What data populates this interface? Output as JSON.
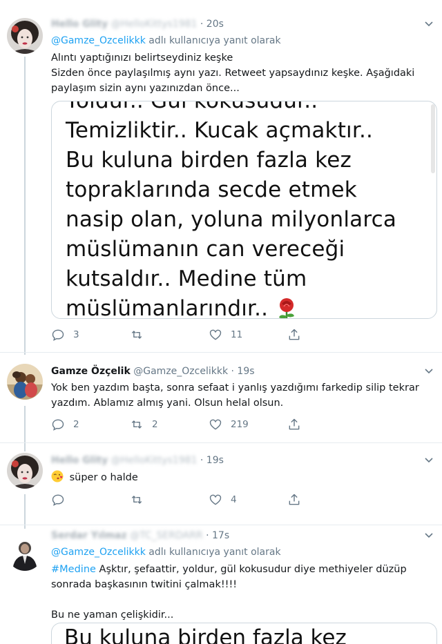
{
  "tweets": [
    {
      "name": "Hello Glity",
      "handle": "@HelloKittys1981",
      "time": "20s",
      "reply_prefix": "@Gamze_Ozcelikkk",
      "reply_suffix": "adlı kullanıcıya yanıt olarak",
      "text_lines": [
        "Alıntı yaptığınızı belirtseydiniz keşke",
        "Sizden önce paylaşılmış aynı yazı. Retweet yapsaydınız keşke. Aşağıdaki",
        "paylaşım sizin aynı yazınızdan önce..."
      ],
      "quote_lines": [
        "Yoldur.. Gül kokusudur..",
        "Temizliktir.. Kucak açmaktır..",
        "Bu kuluna birden fazla kez",
        "topraklarında secde etmek",
        "nasip olan, yoluna milyonlarca",
        "müslümanın can vereceği",
        "kutsaldır.. Medine tüm",
        "müslümanlarındır.."
      ],
      "replies": "3",
      "retweets": "",
      "likes": "11"
    },
    {
      "name": "Gamze Özçelik",
      "handle": "@Gamze_Ozcelikkk",
      "time": "19s",
      "text_lines": [
        "Yok ben yazdım başta, sonra sefaat i yanlış yazdığımı farkedip silip tekrar",
        "yazdım. Ablamız almış yani. Olsun helal olsun."
      ],
      "replies": "2",
      "retweets": "2",
      "likes": "219"
    },
    {
      "name": "Hello Glity",
      "handle": "@HelloKittys1981",
      "time": "19s",
      "text": "süper o halde",
      "replies": "",
      "retweets": "",
      "likes": "4"
    },
    {
      "name": "Serdar Yılmaz",
      "handle": "@TC_SERDARR",
      "time": "17s",
      "reply_prefix": "@Gamze_Ozcelikkk",
      "reply_suffix": "adlı kullanıcıya yanıt olarak",
      "hashtag": "#Medine",
      "text_line1_rest": " Aşktır, şefaattir, yoldur, gül kokusudur diye methiyeler düzüp",
      "text_line2": "sonrada başkasının twitini çalmak!!!!",
      "text_line3": "Bu ne yaman çelişkidir...",
      "quote_peek": "Bu kuluna birden fazla kez"
    }
  ],
  "icons": {
    "reply": "reply-icon",
    "retweet": "retweet-icon",
    "like": "heart-icon",
    "share": "share-icon",
    "caret": "chevron-down-icon",
    "rose": "rose-emoji",
    "kiss": "face-blowing-kiss-emoji"
  },
  "colors": {
    "link": "#1da1f2",
    "muted": "#657786",
    "text": "#14171a",
    "border": "#ccd6dd"
  }
}
